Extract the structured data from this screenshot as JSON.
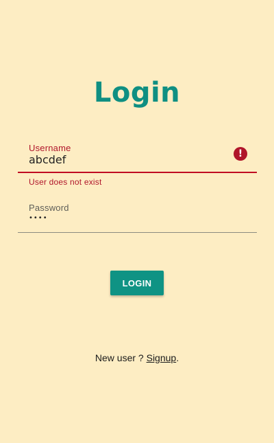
{
  "title": "Login",
  "username": {
    "label": "Username",
    "value": "abcdef",
    "error_icon": "!",
    "error_text": "User does not exist"
  },
  "password": {
    "label": "Password",
    "value": "••••"
  },
  "login_button": {
    "label": "LOGIN"
  },
  "signup": {
    "prompt": "New user ? ",
    "link": "Signup",
    "suffix": "."
  },
  "colors": {
    "background": "#fdedc3",
    "accent": "#0f9384",
    "error": "#b0152a"
  },
  "icons": {
    "error": "error-icon"
  }
}
